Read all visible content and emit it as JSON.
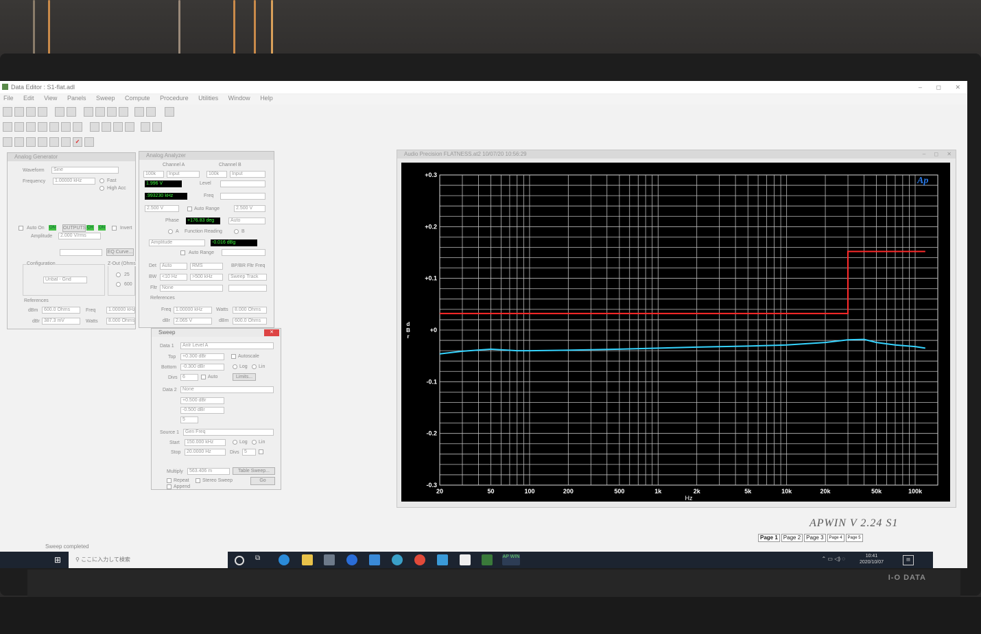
{
  "app": {
    "title": "Data Editor : S1-flat.adl",
    "window_controls": [
      "–",
      "◻",
      "✕"
    ]
  },
  "menu": [
    "File",
    "Edit",
    "View",
    "Panels",
    "Sweep",
    "Compute",
    "Procedure",
    "Utilities",
    "Window",
    "Help"
  ],
  "analog_generator": {
    "title": "Analog Generator",
    "waveform_label": "Waveform",
    "waveform_value": "Sine",
    "frequency_label": "Frequency",
    "frequency_value": "1.00000 kHz",
    "fast_label": "Fast",
    "high_acc_label": "High Acc",
    "auto_on_label": "Auto On",
    "outputs_label": "OUTPUTS",
    "on_tag": "ON",
    "ch_tag": "CH",
    "invert_label": "Invert",
    "amplitude_label": "Amplitude",
    "amplitude_value": "2.000   V/rms",
    "eq_curve_label": "EQ Curve...",
    "configuration_label": "Configuration",
    "configuration_value": "Unbal - Gnd",
    "zout_label": "Z-Out (Ohms",
    "zout_25": "25",
    "zout_600": "600",
    "references_label": "References",
    "dbm_label": "dBm",
    "dbm_value": "600.0   Ohms",
    "freq_label": "Freq",
    "freq_value": "1.00000 kHz",
    "dbr_label": "dBr",
    "dbr_value": "387.3   mV",
    "watts_label": "Watts",
    "watts_value": "8.000   Ohms"
  },
  "analog_analyzer": {
    "title": "Analog Analyzer",
    "channel_a_label": "Channel A",
    "channel_b_label": "Channel B",
    "range_a": "100k",
    "input_a": "Input",
    "range_b": "100k",
    "input_b": "Input",
    "level_a_display": "1.996   V",
    "level_label": "Level",
    "freq_a_display": ".993230 kHz",
    "freq_label": "Freq",
    "range_a_value": "2.500   V",
    "auto_range_label": "Auto Range",
    "range_b_value": "2.500   V",
    "phase_label": "Phase",
    "phase_display": "+176.83 deg",
    "phase_mode": "Auto",
    "function_reading_label": "Function Reading",
    "a_label": "A",
    "b_label": "B",
    "function_mode": "Amplitude",
    "function_display": "-0.016 dBg",
    "auto_range_label_2": "Auto Range",
    "det_label": "Det",
    "det_value": "Auto",
    "det_type": "RMS",
    "bpbr_label": "BP/BR Fltr Freq",
    "bw_label": "BW",
    "bw_low": "<10 Hz",
    "bw_high": ">500 kHz",
    "sweep_track": "Sweep Track",
    "fltr_label": "Fltr",
    "fltr_value": "None",
    "references_label": "References",
    "ref_freq_label": "Freq",
    "ref_freq_value": "1.00000 kHz",
    "ref_watts_label": "Watts",
    "ref_watts_value": "8.000   Ohms",
    "ref_dbr_label": "dBr",
    "ref_dbr_value": "2.065   V",
    "ref_dbm_label": "dBm",
    "ref_dbm_value": "600.0   Ohms"
  },
  "sweep": {
    "title": "Sweep",
    "data1_label": "Data 1",
    "data1_value": "Anlr Level A",
    "top_label": "Top",
    "top_value": "+0.300   dBr",
    "autoscale_label": "Autoscale",
    "bottom_label": "Bottom",
    "bottom_value": "-0.300   dBr",
    "log_label": "Log",
    "lin_label": "Lin",
    "divs_label": "Divs",
    "divs_value": "6",
    "auto_label": "Auto",
    "limits_label": "Limits...",
    "data2_label": "Data 2",
    "data2_value": "None",
    "top2_value": "+0.500   dBr",
    "bottom2_value": "-0.500   dBr",
    "divs2_value": "5",
    "source1_label": "Source 1",
    "source1_value": "Gen Freq",
    "start_label": "Start",
    "start_value": "150.000 kHz",
    "stop_label": "Stop",
    "stop_value": "20.0000 Hz",
    "steps_label": "Divs",
    "steps_value": "5",
    "multiply_label": "Multiply",
    "multiply_value": "563.406 m",
    "table_sweep_label": "Table Sweep...",
    "repeat_label": "Repeat",
    "stereo_sweep_label": "Stereo Sweep",
    "append_label": "Append",
    "go_label": "Go"
  },
  "graph": {
    "title": "Audio Precision  FLATNESS.at2   10/07/20 10:56:29",
    "logo": "Ap",
    "y_unit_label": "dBr",
    "x_unit_label": "Hz",
    "trace_colors": {
      "red": "#ff2a2a",
      "cyan": "#36d4ff"
    }
  },
  "chart_data": {
    "type": "line",
    "x_scale": "log",
    "xlim": [
      20,
      150000
    ],
    "ylim": [
      -0.3,
      0.3
    ],
    "grid": true,
    "xlabel": "Hz",
    "ylabel": "d B r",
    "x_ticks": [
      {
        "v": 20,
        "t": "20"
      },
      {
        "v": 50,
        "t": "50"
      },
      {
        "v": 100,
        "t": "100"
      },
      {
        "v": 200,
        "t": "200"
      },
      {
        "v": 500,
        "t": "500"
      },
      {
        "v": 1000,
        "t": "1k"
      },
      {
        "v": 2000,
        "t": "2k"
      },
      {
        "v": 5000,
        "t": "5k"
      },
      {
        "v": 10000,
        "t": "10k"
      },
      {
        "v": 20000,
        "t": "20k"
      },
      {
        "v": 50000,
        "t": "50k"
      },
      {
        "v": 100000,
        "t": "100k"
      }
    ],
    "y_ticks": [
      {
        "v": 0.3,
        "t": "+0.3"
      },
      {
        "v": 0.2,
        "t": "+0.2"
      },
      {
        "v": 0.1,
        "t": "+0.1"
      },
      {
        "v": 0.0,
        "t": "+0"
      },
      {
        "v": -0.1,
        "t": "-0.1"
      },
      {
        "v": -0.2,
        "t": "-0.2"
      },
      {
        "v": -0.3,
        "t": "-0.3"
      }
    ],
    "series": [
      {
        "color": "#ff2a2a",
        "points": [
          [
            20,
            0.032
          ],
          [
            30000,
            0.032
          ],
          [
            30000,
            0.152
          ],
          [
            120000,
            0.152
          ]
        ]
      },
      {
        "color": "#36d4ff",
        "points": [
          [
            20,
            -0.046
          ],
          [
            30,
            -0.041
          ],
          [
            50,
            -0.037
          ],
          [
            80,
            -0.04
          ],
          [
            100,
            -0.04
          ],
          [
            200,
            -0.039
          ],
          [
            500,
            -0.037
          ],
          [
            1000,
            -0.035
          ],
          [
            2000,
            -0.033
          ],
          [
            5000,
            -0.031
          ],
          [
            10000,
            -0.029
          ],
          [
            20000,
            -0.024
          ],
          [
            30000,
            -0.019
          ],
          [
            40000,
            -0.018
          ],
          [
            50000,
            -0.024
          ],
          [
            70000,
            -0.029
          ],
          [
            100000,
            -0.032
          ],
          [
            120000,
            -0.035
          ]
        ]
      }
    ]
  },
  "apwin_version": "APWIN V 2.24  S1",
  "page_tabs": [
    "Page 1",
    "Page 2",
    "Page 3",
    "Page 4",
    "Page 5"
  ],
  "status": "Sweep completed",
  "taskbar": {
    "search_placeholder": "ここに入力して検索",
    "time": "10:41",
    "date": "2020/10/07",
    "apwin_icon_label": "AP WIN"
  },
  "monitor_brand": "I-O DATA"
}
